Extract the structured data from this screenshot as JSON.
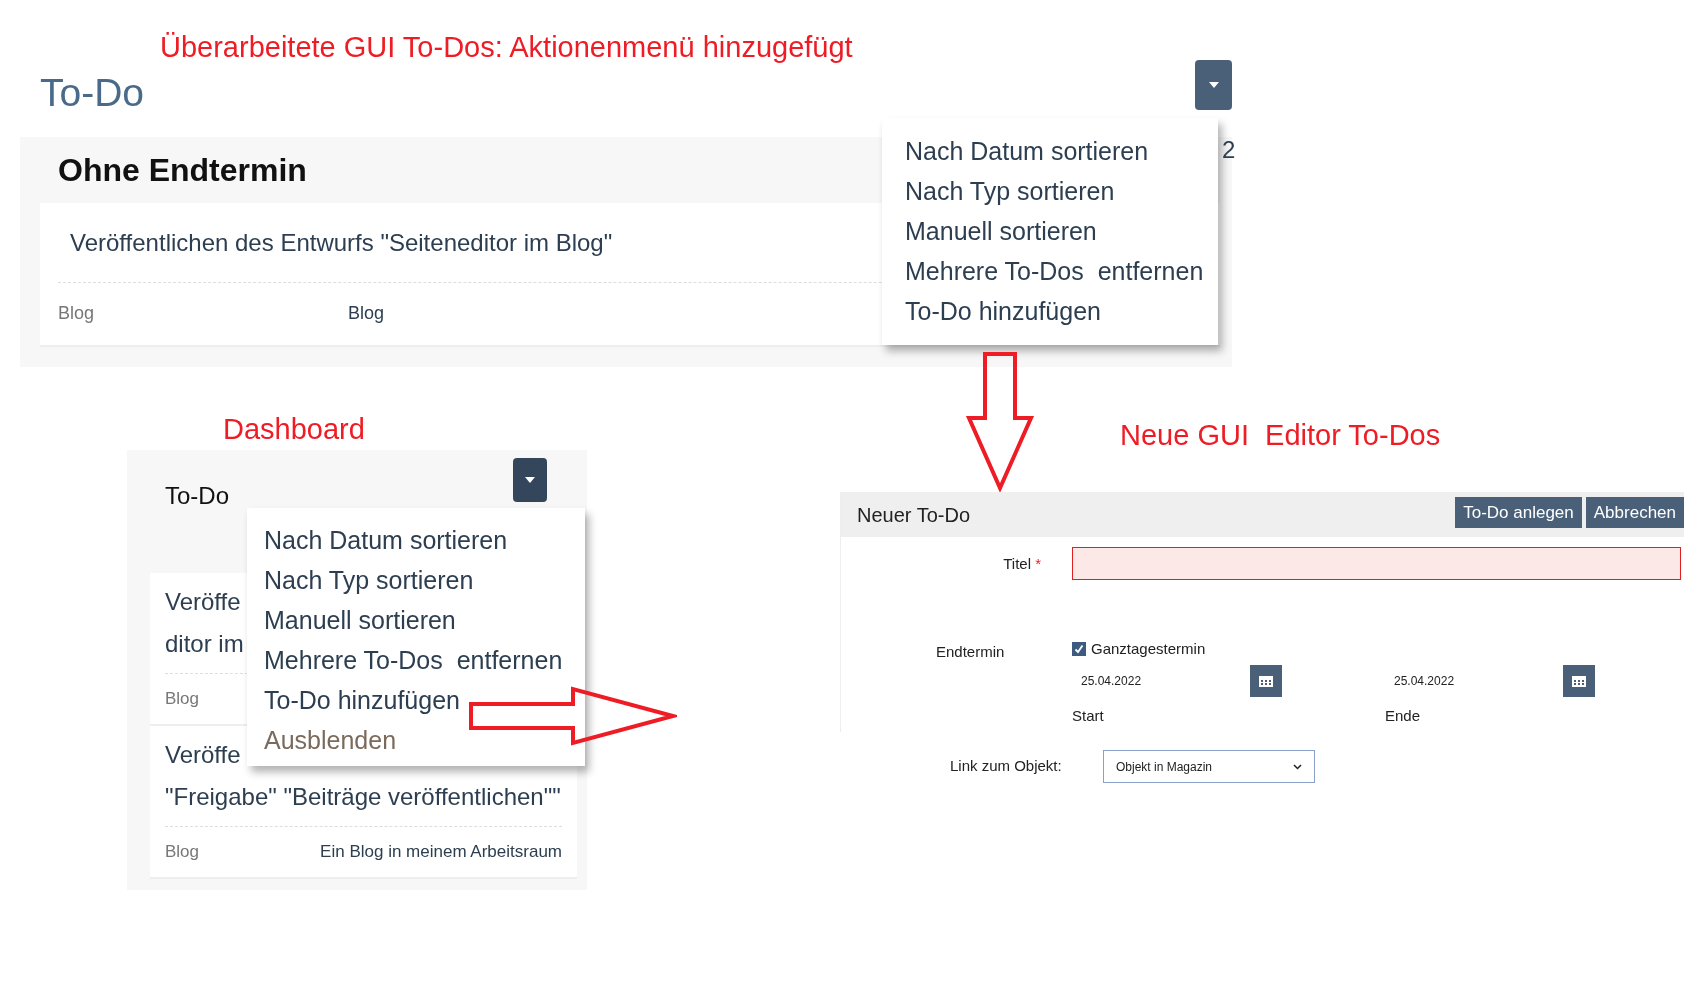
{
  "annotations": {
    "revised": "Überarbeitete GUI To-Dos: Aktionenmenü hinzugefügt",
    "dashboard": "Dashboard",
    "editor": "Neue GUI  Editor To-Dos"
  },
  "page": {
    "title": "To-Do",
    "count_fragment": "2",
    "section": {
      "title": "Ohne Endtermin",
      "items": [
        {
          "title": "Veröffentlichen des Entwurfs \"Seiteneditor im Blog\"",
          "type": "Blog",
          "source": "Blog"
        }
      ]
    },
    "menu": {
      "open": true,
      "items": [
        {
          "label": "Nach Datum sortieren",
          "kind": "action"
        },
        {
          "label": "Nach Typ sortieren",
          "kind": "action"
        },
        {
          "label": "Manuell sortieren",
          "kind": "action"
        },
        {
          "label": "Mehrere To-Dos  entfernen",
          "kind": "action"
        },
        {
          "label": "To-Do hinzufügen",
          "kind": "action"
        }
      ]
    }
  },
  "dashboard": {
    "title": "To-Do",
    "menu": {
      "open": true,
      "items": [
        {
          "label": "Nach Datum sortieren",
          "kind": "action"
        },
        {
          "label": "Nach Typ sortieren",
          "kind": "action"
        },
        {
          "label": "Manuell sortieren",
          "kind": "action"
        },
        {
          "label": "Mehrere To-Dos  entfernen",
          "kind": "action"
        },
        {
          "label": "To-Do hinzufügen",
          "kind": "action"
        },
        {
          "label": "Ausblenden",
          "kind": "muted"
        }
      ]
    },
    "items": [
      {
        "title_lines": [
          "Veröffe",
          "ditor im"
        ],
        "type": "Blog"
      },
      {
        "title_lines": [
          "Veröffe",
          "\"Freigabe\" \"Beiträge veröffentlichen\"\""
        ],
        "type": "Blog",
        "source": "Ein Blog in meinem Arbeitsraum"
      }
    ]
  },
  "editor": {
    "title": "Neuer To-Do",
    "buttons": [
      "To-Do anlegen",
      "Abbrechen"
    ],
    "title_field": {
      "label": "Titel",
      "required_mark": "*",
      "invalid": true
    },
    "end_date": {
      "label": "Endtermin",
      "all_day": {
        "label": "Ganztagestermin",
        "checked": true
      },
      "dates": [
        {
          "value": "25.04.2022",
          "label": "Start"
        },
        {
          "value": "25.04.2022",
          "label": "Ende"
        }
      ]
    },
    "link": {
      "label": "Link zum Objekt:",
      "value": "Objekt in Magazin"
    }
  }
}
